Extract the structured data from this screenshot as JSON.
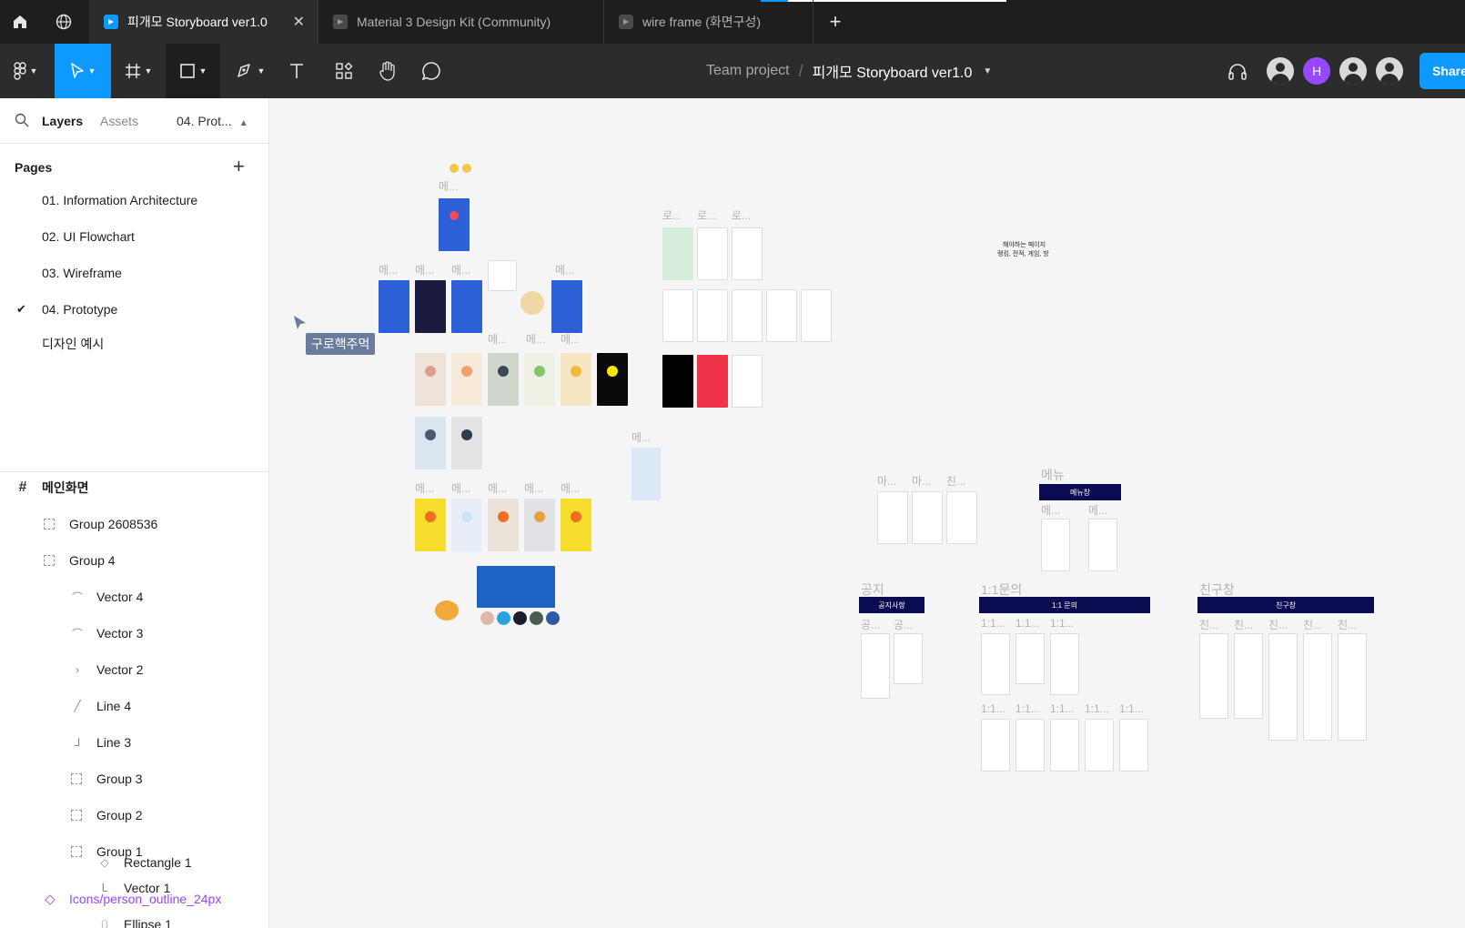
{
  "tabs": [
    {
      "label": "피개모 Storyboard ver1.0",
      "active": true
    },
    {
      "label": "Material 3 Design Kit (Community)",
      "active": false
    },
    {
      "label": "wire frame (화면구성)",
      "active": false
    }
  ],
  "toolbar": {
    "team": "Team project",
    "file_name": "피개모 Storyboard ver1.0",
    "avatar_letter": "H",
    "share_label": "Share"
  },
  "left_panel": {
    "tab_layers": "Layers",
    "tab_assets": "Assets",
    "current_page": "04. Prot...",
    "pages_header": "Pages",
    "pages": [
      "01. Information Architecture",
      "02. UI Flowchart",
      "03. Wireframe",
      "04. Prototype",
      "디자인 예시"
    ],
    "layers": [
      "메인화면",
      "Group 2608536",
      "Group 4",
      "Vector 4",
      "Vector 3",
      "Vector 2",
      "Line 4",
      "Line 3",
      "Group 3",
      "Group 2",
      "Group 1",
      "Vector 1",
      "Ellipse 1",
      "Rectangle 1",
      "Icons/person_outline_24px"
    ]
  },
  "canvas": {
    "cursor_name": "구로핵주먹",
    "labels": {
      "me": "메...",
      "ro": "로...",
      "ma": "마...",
      "chin": "친...",
      "gong": "공...",
      "menu": "메뉴",
      "notice": "공지",
      "inquiry": "1:1문의",
      "friends": "친구창",
      "inq_short": "1:1...",
      "menu_tag": "메뉴창",
      "notice_tag": "공지사항",
      "inquiry_tag": "1:1 문의",
      "friends_tag": "친구창",
      "must_pages_1": "해야하는 페이지",
      "must_pages_2": "랭킹, 전적, 게임, 방"
    }
  },
  "colors": {
    "accent": "#0d99ff",
    "component": "#9747ff",
    "navy_tag": "#0b0b52"
  }
}
